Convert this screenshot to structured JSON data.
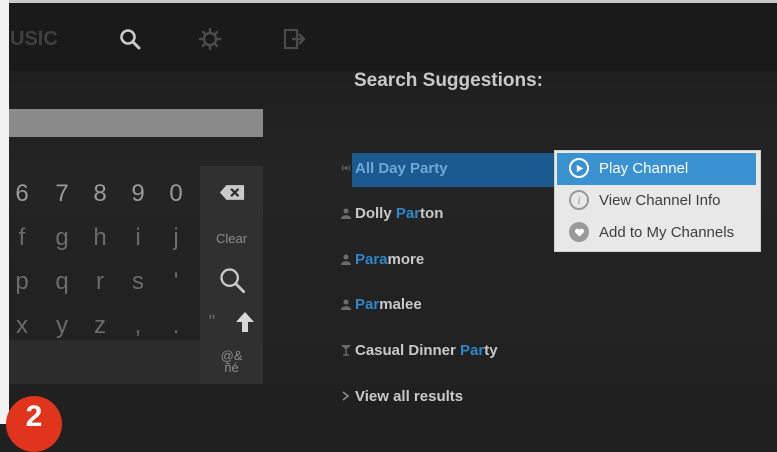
{
  "nav": {
    "music_label": "USIC",
    "icons": [
      "search-icon",
      "gear-icon",
      "exit-icon"
    ]
  },
  "search": {
    "query": ""
  },
  "keyboard": {
    "rows": [
      [
        "6",
        "7",
        "8",
        "9",
        "0"
      ],
      [
        "f",
        "g",
        "h",
        "i",
        "j"
      ],
      [
        "p",
        "q",
        "r",
        "s",
        "'"
      ],
      [
        "x",
        "y",
        "z",
        ",",
        "."
      ]
    ],
    "clear_label": "Clear",
    "quote_label": "\"",
    "symbols_label": "@&\nñé"
  },
  "suggestions": {
    "title": "Search Suggestions:",
    "items": [
      {
        "pre": "All Day ",
        "hl": "Par",
        "post": "ty",
        "icon": "radio-icon"
      },
      {
        "pre": "Dolly ",
        "hl": "Par",
        "post": "ton",
        "icon": "person-icon"
      },
      {
        "pre": "",
        "hl": "Para",
        "post": "more",
        "icon": "person-icon"
      },
      {
        "pre": "",
        "hl": "Par",
        "post": "malee",
        "icon": "person-icon"
      },
      {
        "pre": "Casual Dinner ",
        "hl": "Par",
        "post": "ty",
        "icon": "glass-icon"
      },
      {
        "pre": "View all results",
        "hl": "",
        "post": "",
        "icon": "chevron-right-icon"
      }
    ]
  },
  "context_menu": {
    "items": [
      {
        "label": "Play Channel",
        "icon": "play-icon"
      },
      {
        "label": "View Channel Info",
        "icon": "info-icon"
      },
      {
        "label": "Add to My Channels",
        "icon": "heart-icon"
      }
    ]
  },
  "badge": {
    "label": "2"
  },
  "colors": {
    "accent": "#2f86c9",
    "selection": "#3b92d1",
    "badge": "#e0341c"
  }
}
